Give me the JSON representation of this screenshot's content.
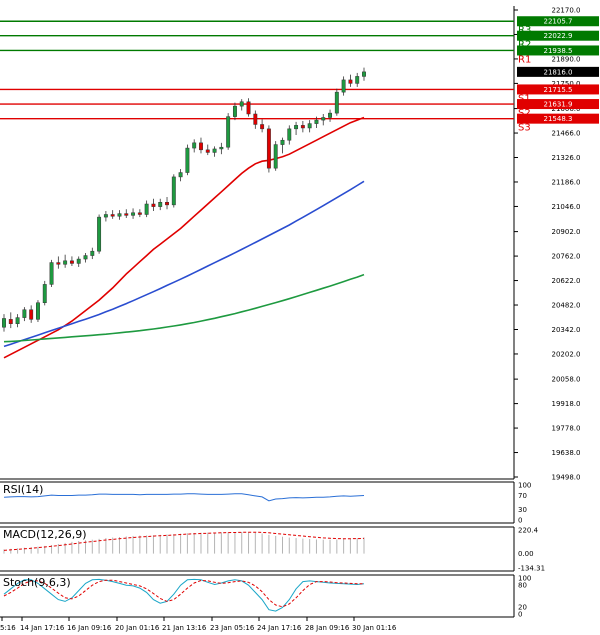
{
  "chart_data": {
    "type": "candlestick",
    "main": {
      "y_axis_ticks": [
        22170.0,
        22030.0,
        21890.0,
        21750.0,
        21606.0,
        21466.0,
        21326.0,
        21186.0,
        21046.0,
        20902.0,
        20762.0,
        20622.0,
        20482.0,
        20342.0,
        20202.0,
        20058.0,
        19918.0,
        19778.0,
        19638.0,
        19498.0
      ],
      "ylim": [
        19498.0,
        22170.0
      ],
      "current_price": 21816.0,
      "levels": [
        {
          "name": "",
          "value": 22105.7,
          "label": "22105.7",
          "color": "#007a00"
        },
        {
          "name": "R3",
          "value": 22022.9,
          "label": "22022.9",
          "color": "#007a00"
        },
        {
          "name": "R2",
          "value": 21938.5,
          "label": "21938.5",
          "color": "#007a00"
        },
        {
          "name": "R1",
          "value": 21715.5,
          "label": "21715.5",
          "color": "#e00000"
        },
        {
          "name": "S1",
          "value": 21631.9,
          "label": "21631.9",
          "color": "#e00000"
        },
        {
          "name": "S2",
          "value": 21548.3,
          "label": "21548.3",
          "color": "#e00000"
        },
        {
          "name": "S3",
          "value": null,
          "label": "",
          "color": "#e00000"
        }
      ],
      "candles": [
        {
          "o": 20355,
          "h": 20430,
          "l": 20330,
          "c": 20405
        },
        {
          "o": 20400,
          "h": 20440,
          "l": 20350,
          "c": 20375
        },
        {
          "o": 20375,
          "h": 20430,
          "l": 20355,
          "c": 20410
        },
        {
          "o": 20410,
          "h": 20470,
          "l": 20390,
          "c": 20455
        },
        {
          "o": 20455,
          "h": 20480,
          "l": 20380,
          "c": 20400
        },
        {
          "o": 20400,
          "h": 20510,
          "l": 20385,
          "c": 20495
        },
        {
          "o": 20495,
          "h": 20620,
          "l": 20480,
          "c": 20600
        },
        {
          "o": 20600,
          "h": 20740,
          "l": 20585,
          "c": 20725
        },
        {
          "o": 20725,
          "h": 20760,
          "l": 20690,
          "c": 20715
        },
        {
          "o": 20715,
          "h": 20770,
          "l": 20695,
          "c": 20735
        },
        {
          "o": 20735,
          "h": 20760,
          "l": 20705,
          "c": 20720
        },
        {
          "o": 20720,
          "h": 20760,
          "l": 20700,
          "c": 20745
        },
        {
          "o": 20745,
          "h": 20780,
          "l": 20725,
          "c": 20765
        },
        {
          "o": 20765,
          "h": 20810,
          "l": 20745,
          "c": 20790
        },
        {
          "o": 20790,
          "h": 21000,
          "l": 20775,
          "c": 20985
        },
        {
          "o": 20985,
          "h": 21020,
          "l": 20960,
          "c": 21000
        },
        {
          "o": 21000,
          "h": 21025,
          "l": 20975,
          "c": 20990
        },
        {
          "o": 20990,
          "h": 21025,
          "l": 20970,
          "c": 21005
        },
        {
          "o": 21005,
          "h": 21030,
          "l": 20980,
          "c": 20995
        },
        {
          "o": 20995,
          "h": 21035,
          "l": 20975,
          "c": 21010
        },
        {
          "o": 21010,
          "h": 21030,
          "l": 20985,
          "c": 21000
        },
        {
          "o": 21000,
          "h": 21080,
          "l": 20985,
          "c": 21060
        },
        {
          "o": 21060,
          "h": 21090,
          "l": 21020,
          "c": 21045
        },
        {
          "o": 21045,
          "h": 21090,
          "l": 21025,
          "c": 21070
        },
        {
          "o": 21070,
          "h": 21100,
          "l": 21030,
          "c": 21055
        },
        {
          "o": 21055,
          "h": 21230,
          "l": 21040,
          "c": 21215
        },
        {
          "o": 21215,
          "h": 21260,
          "l": 21190,
          "c": 21240
        },
        {
          "o": 21240,
          "h": 21400,
          "l": 21225,
          "c": 21380
        },
        {
          "o": 21380,
          "h": 21430,
          "l": 21355,
          "c": 21410
        },
        {
          "o": 21410,
          "h": 21440,
          "l": 21350,
          "c": 21370
        },
        {
          "o": 21370,
          "h": 21400,
          "l": 21340,
          "c": 21355
        },
        {
          "o": 21355,
          "h": 21390,
          "l": 21330,
          "c": 21375
        },
        {
          "o": 21375,
          "h": 21410,
          "l": 21345,
          "c": 21385
        },
        {
          "o": 21385,
          "h": 21580,
          "l": 21370,
          "c": 21560
        },
        {
          "o": 21560,
          "h": 21640,
          "l": 21540,
          "c": 21620
        },
        {
          "o": 21620,
          "h": 21660,
          "l": 21595,
          "c": 21645
        },
        {
          "o": 21645,
          "h": 21665,
          "l": 21560,
          "c": 21575
        },
        {
          "o": 21575,
          "h": 21595,
          "l": 21490,
          "c": 21515
        },
        {
          "o": 21515,
          "h": 21545,
          "l": 21470,
          "c": 21490
        },
        {
          "o": 21490,
          "h": 21510,
          "l": 21240,
          "c": 21265
        },
        {
          "o": 21265,
          "h": 21420,
          "l": 21250,
          "c": 21400
        },
        {
          "o": 21400,
          "h": 21440,
          "l": 21350,
          "c": 21425
        },
        {
          "o": 21425,
          "h": 21510,
          "l": 21400,
          "c": 21490
        },
        {
          "o": 21490,
          "h": 21530,
          "l": 21455,
          "c": 21510
        },
        {
          "o": 21510,
          "h": 21535,
          "l": 21470,
          "c": 21495
        },
        {
          "o": 21495,
          "h": 21540,
          "l": 21470,
          "c": 21520
        },
        {
          "o": 21520,
          "h": 21560,
          "l": 21495,
          "c": 21540
        },
        {
          "o": 21540,
          "h": 21575,
          "l": 21510,
          "c": 21555
        },
        {
          "o": 21555,
          "h": 21600,
          "l": 21530,
          "c": 21580
        },
        {
          "o": 21580,
          "h": 21720,
          "l": 21565,
          "c": 21700
        },
        {
          "o": 21700,
          "h": 21790,
          "l": 21680,
          "c": 21770
        },
        {
          "o": 21770,
          "h": 21800,
          "l": 21730,
          "c": 21750
        },
        {
          "o": 21750,
          "h": 21810,
          "l": 21730,
          "c": 21790
        },
        {
          "o": 21790,
          "h": 21840,
          "l": 21765,
          "c": 21816
        }
      ],
      "ma_series": [
        {
          "color": "#e00000",
          "start": 0,
          "values": [
            20180,
            20200,
            20220,
            20240,
            20260,
            20280,
            20300,
            20320,
            20340,
            20365,
            20390,
            20420,
            20450,
            20480,
            20510,
            20545,
            20580,
            20620,
            20660,
            20695,
            20730,
            20765,
            20800,
            20830,
            20860,
            20890,
            20920,
            20955,
            20990,
            21025,
            21060,
            21095,
            21130,
            21165,
            21200,
            21235,
            21265,
            21290,
            21305,
            21310,
            21320,
            21330,
            21345,
            21365,
            21385,
            21405,
            21425,
            21445,
            21465,
            21485,
            21505,
            21525,
            21540,
            21555
          ]
        },
        {
          "color": "#2a4dd0",
          "start": 0,
          "values": [
            20245,
            20258,
            20271,
            20284,
            20297,
            20310,
            20323,
            20336,
            20349,
            20362,
            20375,
            20388,
            20401,
            20414,
            20428,
            20443,
            20458,
            20474,
            20490,
            20507,
            20524,
            20541,
            20558,
            20576,
            20594,
            20612,
            20630,
            20648,
            20667,
            20686,
            20705,
            20724,
            20743,
            20762,
            20781,
            20800,
            20820,
            20840,
            20860,
            20880,
            20900,
            20920,
            20940,
            20962,
            20984,
            21006,
            21028,
            21050,
            21073,
            21096,
            21119,
            21142,
            21166,
            21190
          ]
        },
        {
          "color": "#1e9a40",
          "start": 0,
          "values": [
            20272,
            20274,
            20276,
            20279,
            20282,
            20285,
            20288,
            20291,
            20294,
            20297,
            20300,
            20303,
            20306,
            20309,
            20312,
            20315,
            20319,
            20323,
            20327,
            20331,
            20335,
            20340,
            20345,
            20350,
            20356,
            20362,
            20368,
            20375,
            20382,
            20390,
            20398,
            20406,
            20415,
            20424,
            20433,
            20443,
            20453,
            20463,
            20474,
            20485,
            20496,
            20507,
            20518,
            20530,
            20542,
            20554,
            20566,
            20578,
            20590,
            20603,
            20616,
            20629,
            20642,
            20656
          ]
        }
      ]
    },
    "x_axis_labels": [
      "5:16",
      "14 Jan 17:16",
      "16 Jan 09:16",
      "20 Jan 01:16",
      "21 Jan 13:16",
      "23 Jan 05:16",
      "24 Jan 17:16",
      "28 Jan 09:16",
      "30 Jan 01:16"
    ],
    "rsi": {
      "title": "RSI(14)",
      "ticks": [
        "100",
        "70",
        "30",
        "0"
      ],
      "ylim": [
        0,
        100
      ],
      "color": "#2a6fd6",
      "values": [
        65,
        66,
        67,
        67,
        66,
        67,
        69,
        71,
        70,
        70,
        70,
        71,
        71,
        72,
        74,
        74,
        73,
        73,
        73,
        73,
        72,
        73,
        73,
        73,
        73,
        74,
        74,
        75,
        75,
        74,
        73,
        73,
        73,
        74,
        75,
        75,
        72,
        69,
        66,
        55,
        60,
        61,
        63,
        64,
        63,
        64,
        65,
        65,
        66,
        68,
        69,
        68,
        69,
        70
      ]
    },
    "macd": {
      "title": "MACD(12,26,9)",
      "ticks": [
        "220.4",
        "0.00",
        "-134.31"
      ],
      "ylim": [
        -134.31,
        220.4
      ],
      "hist_color": "#b4b4b4",
      "signal_color": "#e00000",
      "hist": [
        40,
        45,
        50,
        55,
        60,
        65,
        72,
        80,
        90,
        100,
        110,
        118,
        125,
        130,
        138,
        145,
        150,
        155,
        160,
        165,
        168,
        170,
        172,
        175,
        178,
        182,
        186,
        190,
        193,
        195,
        196,
        197,
        198,
        199,
        200,
        202,
        200,
        195,
        188,
        175,
        165,
        158,
        150,
        145,
        140,
        136,
        132,
        130,
        130,
        132,
        136,
        140,
        145,
        150
      ],
      "signal": [
        30,
        35,
        40,
        45,
        50,
        56,
        62,
        68,
        75,
        82,
        90,
        98,
        106,
        113,
        120,
        127,
        133,
        139,
        145,
        150,
        155,
        159,
        163,
        167,
        170,
        174,
        178,
        182,
        185,
        188,
        190,
        192,
        194,
        196,
        197,
        199,
        200,
        200,
        198,
        194,
        188,
        182,
        176,
        170,
        164,
        158,
        152,
        147,
        143,
        140,
        139,
        139,
        140,
        142
      ]
    },
    "stoch": {
      "title": "Stoch(9,6,3)",
      "ticks": [
        "100",
        "80",
        "20",
        "0"
      ],
      "ylim": [
        0,
        100
      ],
      "k_color": "#1aa6c8",
      "d_color": "#e00000",
      "k": [
        55,
        70,
        85,
        95,
        95,
        85,
        70,
        55,
        40,
        35,
        45,
        65,
        85,
        95,
        96,
        94,
        90,
        85,
        80,
        78,
        72,
        60,
        40,
        30,
        35,
        55,
        80,
        95,
        96,
        95,
        88,
        82,
        86,
        92,
        95,
        92,
        80,
        60,
        40,
        12,
        8,
        18,
        40,
        70,
        90,
        92,
        90,
        88,
        86,
        85,
        84,
        83,
        82,
        84
      ],
      "d": [
        50,
        60,
        72,
        85,
        92,
        92,
        85,
        72,
        58,
        45,
        42,
        50,
        65,
        80,
        90,
        94,
        94,
        90,
        86,
        82,
        78,
        70,
        57,
        43,
        35,
        40,
        55,
        72,
        86,
        93,
        92,
        88,
        85,
        87,
        90,
        92,
        88,
        78,
        62,
        40,
        25,
        20,
        28,
        45,
        65,
        82,
        90,
        90,
        89,
        87,
        86,
        85,
        84,
        84
      ]
    }
  }
}
